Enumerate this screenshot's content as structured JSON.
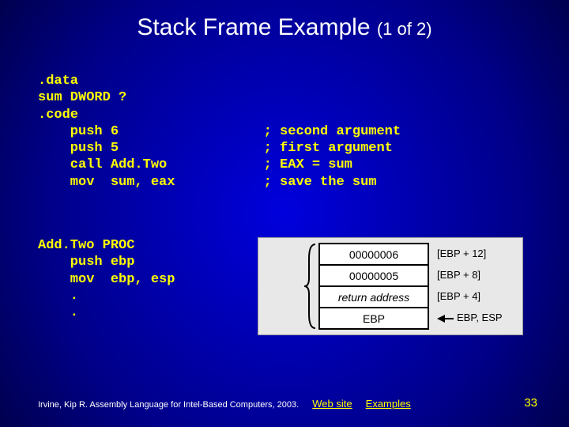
{
  "title": {
    "main": "Stack Frame Example",
    "sub": "(1 of 2)"
  },
  "code1": ".data\nsum DWORD ?\n.code\n    push 6                  ; second argument\n    push 5                  ; first argument\n    call Add.Two            ; EAX = sum\n    mov  sum, eax           ; save the sum",
  "code2": "Add.Two PROC\n    push ebp\n    mov  ebp, esp\n    .\n    .",
  "stack": {
    "rows": [
      {
        "val": "00000006",
        "label": "[EBP + 12]"
      },
      {
        "val": "00000005",
        "label": "[EBP + 8]"
      },
      {
        "val": "return address",
        "label": "[EBP + 4]",
        "italic": true
      },
      {
        "val": "EBP",
        "label": "EBP, ESP",
        "arrow": true
      }
    ]
  },
  "footer": {
    "cite": "Irvine, Kip R. Assembly Language for Intel-Based Computers, 2003.",
    "link1": "Web site",
    "link2": "Examples"
  },
  "page": "33"
}
